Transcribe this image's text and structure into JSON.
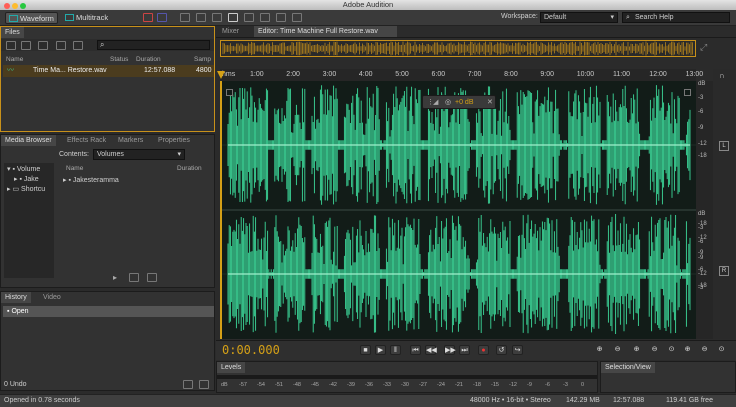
{
  "window": {
    "title": "Adobe Audition"
  },
  "toolbar": {
    "waveform": "Waveform",
    "multitrack": "Multitrack",
    "workspace_label": "Workspace:",
    "workspace_value": "Default",
    "search_placeholder": "Search Help"
  },
  "files": {
    "tab": "Files",
    "col_name": "Name",
    "col_status": "Status",
    "col_duration": "Duration",
    "col_samp": "Samp",
    "file_name": "Time Ma... Restore.wav",
    "file_duration": "12:57.088",
    "file_rate": "4800"
  },
  "media": {
    "tabs": [
      "Media Browser",
      "Effects Rack",
      "Markers",
      "Properties"
    ],
    "contents_label": "Contents:",
    "contents_value": "Volumes",
    "tree": [
      "Volume",
      "Jake",
      "Shortcu"
    ],
    "col_name": "Name",
    "col_duration": "Duration",
    "item": "Jakesteramma"
  },
  "history": {
    "tabs": [
      "History",
      "Video"
    ],
    "item": "Open",
    "undo": "0 Undo"
  },
  "editor": {
    "mixer_tab": "Mixer",
    "editor_tab": "Editor: Time Machine Full Restore.wav",
    "hud_gain": "+0 dB",
    "time": "0:00.000",
    "ruler_unit": "hms",
    "ruler": [
      "1:00",
      "2:00",
      "3:00",
      "4:00",
      "5:00",
      "6:00",
      "7:00",
      "8:00",
      "9:00",
      "10:00",
      "11:00",
      "12:00",
      "13:00",
      "1:"
    ],
    "db_labels": [
      "dB",
      "-3",
      "-6",
      "-9",
      "-12",
      "-18",
      "-18",
      "-12",
      "-9",
      "-6",
      "-3"
    ],
    "channels": [
      "L",
      "R"
    ]
  },
  "levels": {
    "tab": "Levels",
    "scale": [
      "dB",
      "-57",
      "-54",
      "-51",
      "-48",
      "-45",
      "-42",
      "-39",
      "-36",
      "-33",
      "-30",
      "-27",
      "-24",
      "-21",
      "-18",
      "-15",
      "-12",
      "-9",
      "-6",
      "-3",
      "0"
    ]
  },
  "selection": {
    "tab": "Selection/View"
  },
  "status": {
    "left": "Opened in 0.78 seconds",
    "format": "48000 Hz • 16-bit • Stereo",
    "size": "142.29 MB",
    "duration": "12:57.088",
    "free": "119.41 GB free"
  },
  "colors": {
    "wave": "#3cd89a",
    "time": "#d4a017",
    "accent": "#2aa"
  }
}
